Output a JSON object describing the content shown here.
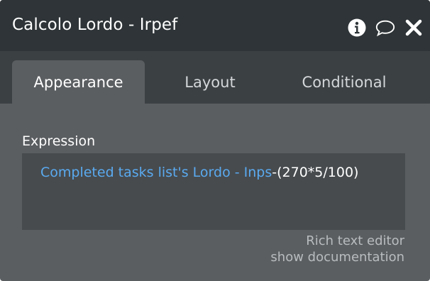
{
  "header": {
    "title": "Calcolo Lordo - Irpef",
    "icons": [
      "info-icon",
      "comment-icon",
      "close-icon"
    ]
  },
  "tabs": [
    {
      "label": "Appearance",
      "active": true
    },
    {
      "label": "Layout",
      "active": false
    },
    {
      "label": "Conditional",
      "active": false
    }
  ],
  "expression": {
    "label": "Expression",
    "dynamic_part": "Completed tasks list's Lordo - Inps",
    "static_part": "-(270*5/100)"
  },
  "links": {
    "rich_text_editor": "Rich text editor",
    "show_documentation": "show documentation"
  },
  "colors": {
    "header_bg": "#2e3437",
    "panel_bg": "#5b5e61",
    "dynamic_expression": "#5aaaf0"
  }
}
